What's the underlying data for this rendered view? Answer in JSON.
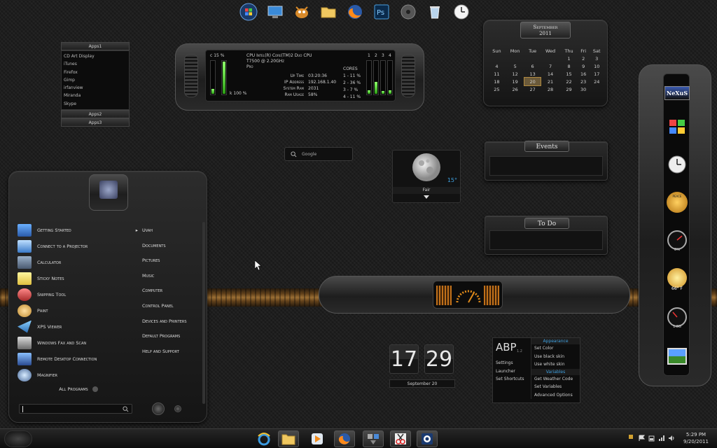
{
  "top_dock": {
    "icons": [
      "windows-start-icon",
      "remote-desktop-icon",
      "gimp-icon",
      "folder-icon",
      "firefox-icon",
      "photoshop-icon",
      "disc-icon",
      "recycle-bin-icon",
      "clock-icon"
    ]
  },
  "apps_widget": {
    "header1": "Apps1",
    "items": [
      "CD Art Display",
      "iTunes",
      "Firefox",
      "Gimp",
      "irfanview",
      "Miranda",
      "Skype"
    ],
    "header2": "Apps2",
    "header3": "Apps3"
  },
  "cpu_meter": {
    "c_label": "c  15 %",
    "k_label": "k  100 %",
    "cpu_line1": "CPU  Intel(R) Core(TM)2 Duo CPU",
    "cpu_line2": "T7500  @ 2.20GHz",
    "cpu_line3": "Pro",
    "uptime_label": "Up Time",
    "uptime_value": "03:20:36",
    "ip_label": "IP  Address",
    "ip_value": "192.168.1.40",
    "ram_label": "System Ram",
    "ram_value": "2031",
    "ram_usage_label": "Ram Usage",
    "ram_usage_value": "58%",
    "cores_label": "CORES",
    "cores": [
      "1 - 11 %",
      "2 - 36 %",
      "3 - 7 %",
      "4 - 11 %"
    ],
    "core_numbers": [
      "1",
      "2",
      "3",
      "4"
    ],
    "core_levels": [
      0.11,
      0.36,
      0.07,
      0.11
    ],
    "left_levels": [
      0.15,
      1.0
    ]
  },
  "calendar": {
    "month": "September",
    "year": "2011",
    "days": [
      "Sun",
      "Mon",
      "Tue",
      "Wed",
      "Thu",
      "Fri",
      "Sat"
    ],
    "weeks": [
      [
        "",
        "",
        "",
        "",
        "1",
        "2",
        "3"
      ],
      [
        "4",
        "5",
        "6",
        "7",
        "8",
        "9",
        "10"
      ],
      [
        "11",
        "12",
        "13",
        "14",
        "15",
        "16",
        "17"
      ],
      [
        "18",
        "19",
        "20",
        "21",
        "22",
        "23",
        "24"
      ],
      [
        "25",
        "26",
        "27",
        "28",
        "29",
        "30",
        ""
      ]
    ],
    "today": "20"
  },
  "events_widget": {
    "title": "Events"
  },
  "todo_widget": {
    "title": "To Do"
  },
  "search_widget": {
    "placeholder": "Google"
  },
  "weather_widget": {
    "temp": "15°",
    "condition": "Fair"
  },
  "start_menu": {
    "left_items": [
      "Getting Started",
      "Connect to a Projector",
      "Calculator",
      "Sticky Notes",
      "Snipping Tool",
      "Paint",
      "XPS Viewer",
      "Windows Fax and Scan",
      "Remote Desktop Connection",
      "Magnifier"
    ],
    "all_programs": "All Programs",
    "right_items": [
      "Uvah",
      "Documents",
      "Pictures",
      "Music",
      "Computer",
      "Control Panel",
      "Devices and Printers",
      "Default Programs",
      "Help and Support"
    ],
    "search_value": ""
  },
  "flip_clock": {
    "hour": "17",
    "minute": "29",
    "date": "September  20"
  },
  "abp_widget": {
    "logo": "ABP",
    "version": "1.2",
    "left_items": [
      "Settings",
      "Launcher",
      "Set Shortcuts"
    ],
    "appearance_header": "Appearance",
    "appearance_items": [
      "Set Color",
      "Use black skin",
      "Use white skin"
    ],
    "variables_header": "Variables",
    "variables_items": [
      "Get Weather Code",
      "Set Variables",
      "Advanced Options"
    ]
  },
  "sidebar": {
    "logo": "NeXuS",
    "weather_temp": "66° F",
    "gauge1_label": "8%",
    "gauge2_label": "1.8G",
    "badge_text": "PEACE"
  },
  "taskbar": {
    "icons": [
      "internet-explorer-icon",
      "explorer-folder-icon",
      "media-player-icon",
      "firefox-icon",
      "sticky-apps-icon",
      "snipping-icon",
      "remote-app-icon"
    ],
    "time": "5:29 PM",
    "date": "9/20/2011"
  },
  "colors": {
    "accent_blue": "#3ea0e0",
    "meter_green": "#5ed43a",
    "copper": "#c58a3c",
    "gauge_orange": "#e08a1a"
  }
}
